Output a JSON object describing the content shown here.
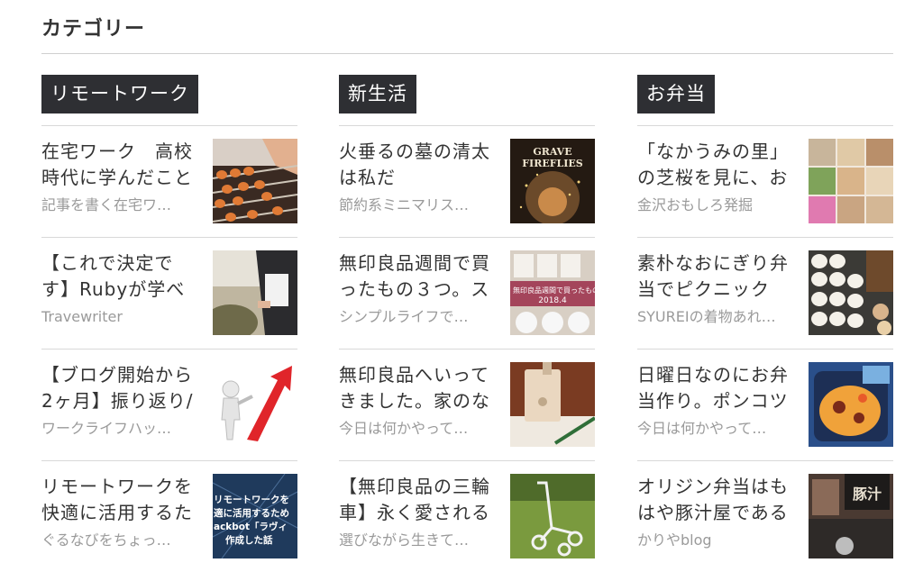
{
  "section": {
    "title": "カテゴリー"
  },
  "columns": [
    {
      "category": "リモートワーク",
      "entries": [
        {
          "title": "在宅ワーク　高校時代に学んだこと",
          "blog": "記事を書く在宅ワ…",
          "thumb_icon": "abacus-image"
        },
        {
          "title": "【これで決定です】Rubyが学べ",
          "blog": "Travewriter",
          "thumb_icon": "person-holding-laptop-image"
        },
        {
          "title": "【ブログ開始から2ヶ月】振り返り/",
          "blog": "ワークライフハッ…",
          "thumb_icon": "growth-arrow-figure-image"
        },
        {
          "title": "リモートワークを快適に活用するた",
          "blog": "ぐるなびをちょっ…",
          "thumb_icon": "remote-work-banner-image"
        }
      ]
    },
    {
      "category": "新生活",
      "entries": [
        {
          "title": "火垂るの墓の清太は私だ",
          "blog": "節約系ミニマリス…",
          "thumb_icon": "movie-poster-image"
        },
        {
          "title": "無印良品週間で買ったもの３つ。ス",
          "blog": "シンプルライフで…",
          "thumb_icon": "muji-products-image"
        },
        {
          "title": "無印良品へいってきました。家のな",
          "blog": "今日は何かやって…",
          "thumb_icon": "pencil-sharpener-image"
        },
        {
          "title": "【無印良品の三輪車】永く愛される",
          "blog": "選びながら生きて…",
          "thumb_icon": "tricycle-image"
        }
      ]
    },
    {
      "category": "お弁当",
      "entries": [
        {
          "title": "「なかうみの里」の芝桜を見に、お",
          "blog": "金沢おもしろ発掘",
          "thumb_icon": "bento-collage-image"
        },
        {
          "title": "素朴なおにぎり弁当でピクニック",
          "blog": "SYUREIの着物あれ…",
          "thumb_icon": "onigiri-bento-image"
        },
        {
          "title": "日曜日なのにお弁当作り。ポンコツ",
          "blog": "今日は何かやって…",
          "thumb_icon": "lunch-box-image"
        },
        {
          "title": "オリジン弁当はもはや豚汁屋である",
          "blog": "かりやblog",
          "thumb_icon": "tonjiru-shop-image"
        }
      ]
    }
  ],
  "image_text": {
    "poster_line1": "GRAVE",
    "poster_line2": "FIREFLIES",
    "muji_date": "2018.4",
    "muji_caption": "無印良品週間で買ったもの",
    "banner_line1": "リモートワークを",
    "banner_line2": "適に活用するため",
    "banner_line3": "ackbot「ラヴィ",
    "banner_line4": "作成した話",
    "shop_sign": "豚汁"
  }
}
